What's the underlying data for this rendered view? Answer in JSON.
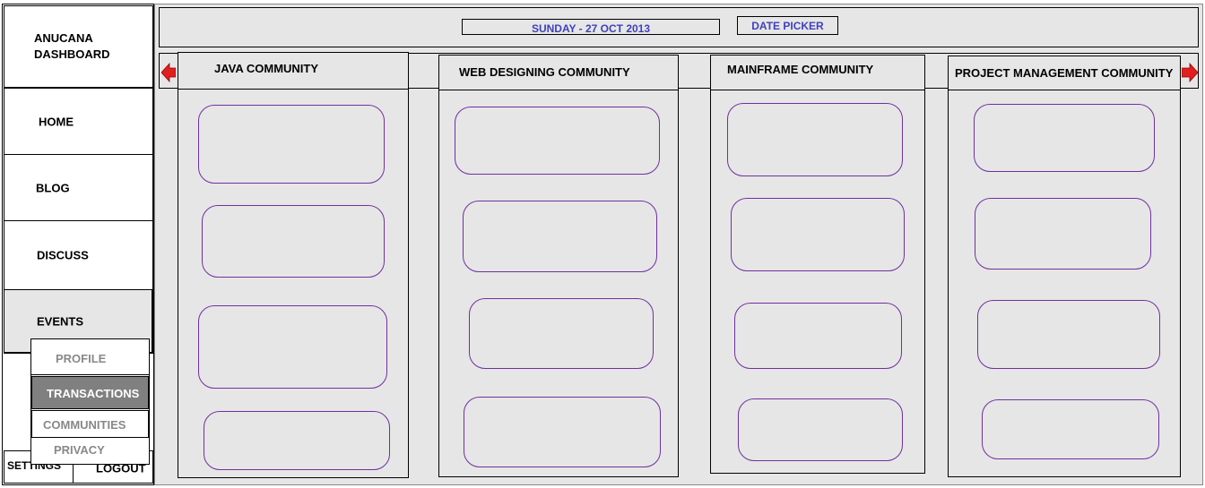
{
  "sidebar": {
    "logo": "ANUCANA DASHBOARD",
    "items": [
      {
        "label": "HOME"
      },
      {
        "label": "BLOG"
      },
      {
        "label": "DISCUSS"
      },
      {
        "label": "EVENTS"
      }
    ],
    "settings_label": "SETTINGS",
    "logout_label": "LOGOUT"
  },
  "dropdown": {
    "items": [
      {
        "label": "PROFILE"
      },
      {
        "label": "TRANSACTIONS"
      },
      {
        "label": "COMMUNITIES"
      },
      {
        "label": "PRIVACY"
      }
    ]
  },
  "header": {
    "date": "SUNDAY - 27 OCT 2013",
    "date_picker_label": "DATE PICKER"
  },
  "communities": [
    {
      "title": "JAVA COMMUNITY"
    },
    {
      "title": "WEB DESIGNING COMMUNITY"
    },
    {
      "title": "MAINFRAME COMMUNITY"
    },
    {
      "title": "PROJECT MANAGEMENT COMMUNITY"
    }
  ],
  "colors": {
    "panel_bg": "#e6e6e6",
    "card_border": "#7030a0",
    "date_text": "#4040bf",
    "arrow": "#e02020",
    "selected_bg": "#808080"
  }
}
